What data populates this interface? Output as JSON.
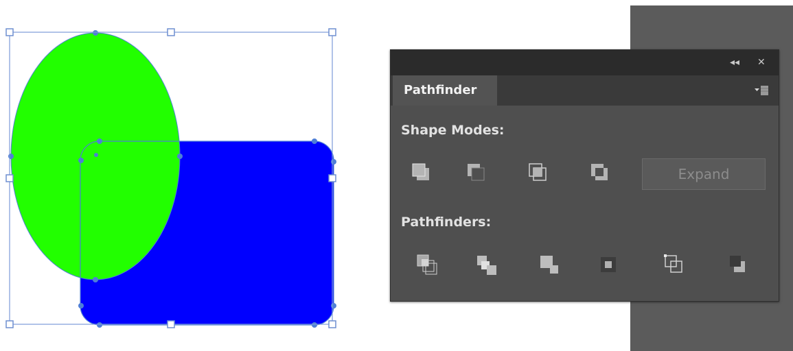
{
  "panel": {
    "tab_label": "Pathfinder",
    "shape_modes_label": "Shape Modes:",
    "pathfinders_label": "Pathfinders:",
    "expand_label": "Expand",
    "collapse_glyph": "◂◂",
    "close_glyph": "✕"
  },
  "colors": {
    "ellipse_fill": "#22ff00",
    "rect_fill": "#0000ff",
    "selection": "#4f7fd6",
    "panel_bg": "#4f4f4f",
    "side_strip": "#5b5b5b"
  },
  "icons": {
    "shape_modes": [
      "unite-icon",
      "minus-front-icon",
      "intersect-icon",
      "exclude-icon"
    ],
    "pathfinders": [
      "divide-icon",
      "trim-icon",
      "merge-icon",
      "crop-icon",
      "outline-icon",
      "minus-back-icon"
    ]
  }
}
